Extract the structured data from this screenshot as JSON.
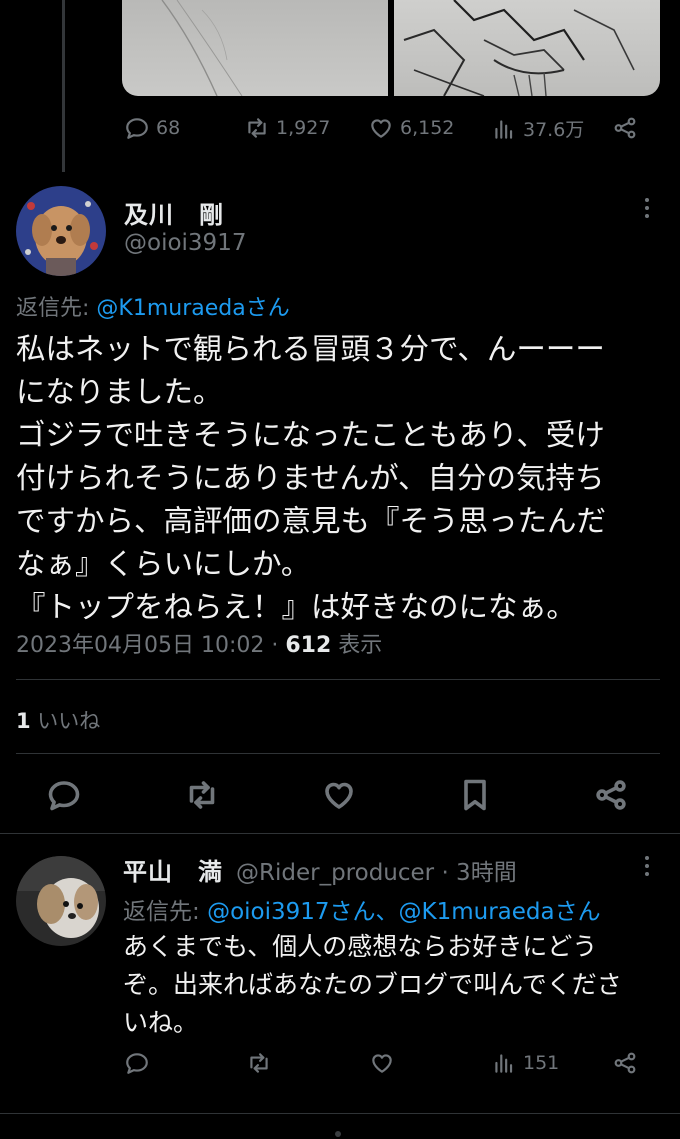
{
  "parent_tweet": {
    "stats": {
      "replies": "68",
      "retweets": "1,927",
      "likes": "6,152",
      "views": "37.6万"
    }
  },
  "main_tweet": {
    "name": "及川　剛",
    "handle": "@oioi3917",
    "reply_to_prefix": "返信先:",
    "reply_to_link": "@K1muraedaさん",
    "text": "私はネットで観られる冒頭３分で、んーーー\nになりました。\nゴジラで吐きそうになったこともあり、受け\n付けられそうにありませんが、自分の気持ち\nですから、高評価の意見も『そう思ったんだ\nなぁ』くらいにしか。\n『トップをねらえ！』は好きなのになぁ。",
    "date": "2023年04月05日 10:02",
    "separator": " · ",
    "views_count": "612",
    "views_label": " 表示",
    "likes_count": "1",
    "likes_label": " いいね"
  },
  "reply_tweet": {
    "name": "平山　満",
    "handle": "@Rider_producer · 3時間",
    "reply_to_prefix": "返信先:",
    "reply_to_links": "@oioi3917さん、@K1muraedaさん",
    "text": "あくまでも、個人の感想ならお好きにどう\nぞ。出来ればあなたのブログで叫んでくださ\nいね。",
    "views": "151"
  },
  "icons": [
    "reply-icon",
    "retweet-icon",
    "like-icon",
    "views-icon",
    "share-icon",
    "bookmark-icon",
    "more-icon"
  ],
  "colors": {
    "background": "#000000",
    "text": "#e7e9ea",
    "muted": "#71767b",
    "link": "#1d9bf0",
    "divider": "#2f3336"
  }
}
